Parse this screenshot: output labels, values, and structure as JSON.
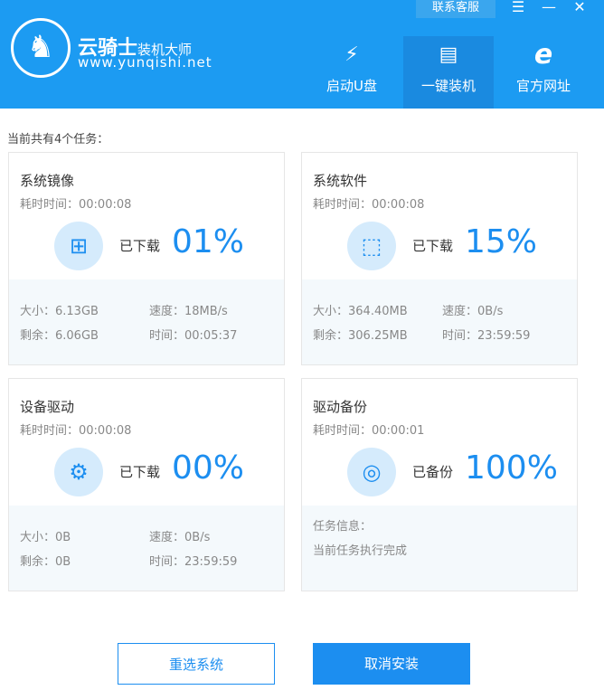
{
  "header": {
    "brand": "云骑士",
    "brand_sub": "装机大师",
    "site": "www.yunqishi.net",
    "contact": "联系客服",
    "nav": [
      {
        "label": "启动U盘",
        "icon": "usb-icon"
      },
      {
        "label": "一键装机",
        "icon": "monitor-icon",
        "active": true
      },
      {
        "label": "官方网址",
        "icon": "ie-icon"
      }
    ]
  },
  "task_count": "当前共有4个任务：",
  "cards": [
    {
      "title": "系统镜像",
      "elapsed": "耗时时间：00:00:08",
      "status": "已下载",
      "percent": "01%",
      "size": "大小：6.13GB",
      "speed": "速度：18MB/s",
      "remain": "剩余：6.06GB",
      "time": "时间：00:05:37"
    },
    {
      "title": "系统软件",
      "elapsed": "耗时时间：00:00:08",
      "status": "已下载",
      "percent": "15%",
      "size": "大小：364.40MB",
      "speed": "速度：0B/s",
      "remain": "剩余：306.25MB",
      "time": "时间：23:59:59"
    },
    {
      "title": "设备驱动",
      "elapsed": "耗时时间：00:00:08",
      "status": "已下载",
      "percent": "00%",
      "size": "大小：0B",
      "speed": "速度：0B/s",
      "remain": "剩余：0B",
      "time": "时间：23:59:59"
    },
    {
      "title": "驱动备份",
      "elapsed": "耗时时间：00:00:01",
      "status": "已备份",
      "percent": "100%",
      "info_label": "任务信息：",
      "info": "当前任务执行完成"
    }
  ],
  "buttons": {
    "reselect": "重选系统",
    "cancel": "取消安装"
  }
}
